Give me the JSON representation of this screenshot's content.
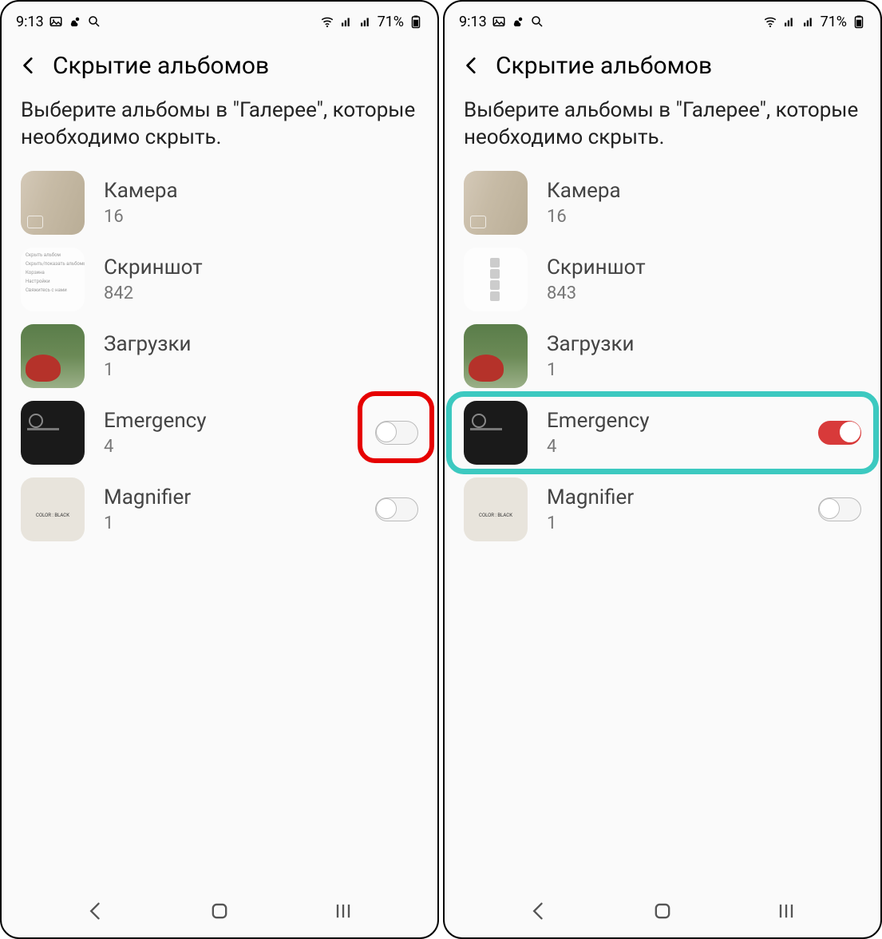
{
  "status": {
    "time": "9:13",
    "battery": "71%"
  },
  "header": {
    "title": "Скрытие альбомов"
  },
  "subhead": "Выберите альбомы в \"Галерее\", которые необходимо скрыть.",
  "panes": [
    {
      "albums": [
        {
          "name": "Камера",
          "count": "16",
          "toggle": null,
          "thumb": "camera"
        },
        {
          "name": "Скриншот",
          "count": "842",
          "toggle": null,
          "thumb": "scr1"
        },
        {
          "name": "Загрузки",
          "count": "1",
          "toggle": null,
          "thumb": "dl"
        },
        {
          "name": "Emergency",
          "count": "4",
          "toggle": "off",
          "thumb": "em",
          "highlight": "red-toggle"
        },
        {
          "name": "Magnifier",
          "count": "1",
          "toggle": "off",
          "thumb": "mag"
        }
      ]
    },
    {
      "albums": [
        {
          "name": "Камера",
          "count": "16",
          "toggle": null,
          "thumb": "camera"
        },
        {
          "name": "Скриншот",
          "count": "843",
          "toggle": null,
          "thumb": "scr2"
        },
        {
          "name": "Загрузки",
          "count": "1",
          "toggle": null,
          "thumb": "dl"
        },
        {
          "name": "Emergency",
          "count": "4",
          "toggle": "on",
          "thumb": "em",
          "highlight": "teal-row"
        },
        {
          "name": "Magnifier",
          "count": "1",
          "toggle": "off",
          "thumb": "mag"
        }
      ]
    }
  ],
  "scr1_lines": [
    "Скрыть альбом",
    "Скрыть/показать альбомы",
    "Корзина",
    "Настройки",
    "Свяжитесь с нами"
  ]
}
